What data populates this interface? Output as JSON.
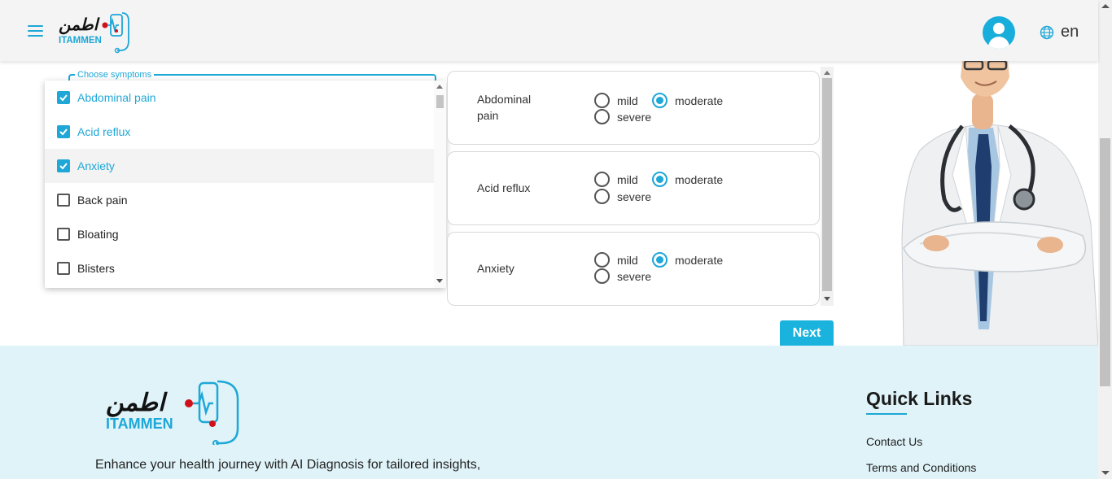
{
  "brand": {
    "arabic": "اطمن",
    "latin": "ITAMMEN",
    "accent": "#1ea7d7",
    "dot": "#d0101b"
  },
  "header": {
    "menu_icon": "hamburger-menu-icon",
    "profile_icon": "user-avatar-icon",
    "language_icon": "globe-icon",
    "language": "en"
  },
  "symptoms": {
    "label": "Choose symptoms",
    "options": [
      {
        "label": "Abdominal pain",
        "checked": true
      },
      {
        "label": "Acid reflux",
        "checked": true
      },
      {
        "label": "Anxiety",
        "checked": true
      },
      {
        "label": "Back pain",
        "checked": false
      },
      {
        "label": "Bloating",
        "checked": false
      },
      {
        "label": "Blisters",
        "checked": false
      }
    ]
  },
  "severity": {
    "options": [
      "mild",
      "moderate",
      "severe"
    ],
    "cards": [
      {
        "name": "Abdominal pain",
        "selected": "moderate"
      },
      {
        "name": "Acid reflux",
        "selected": "moderate"
      },
      {
        "name": "Anxiety",
        "selected": "moderate"
      }
    ]
  },
  "actions": {
    "next": "Next"
  },
  "footer": {
    "tagline": "Enhance your health journey with AI Diagnosis for tailored insights,",
    "quick_links_title": "Quick Links",
    "links": [
      "Contact Us",
      "Terms and Conditions"
    ]
  }
}
